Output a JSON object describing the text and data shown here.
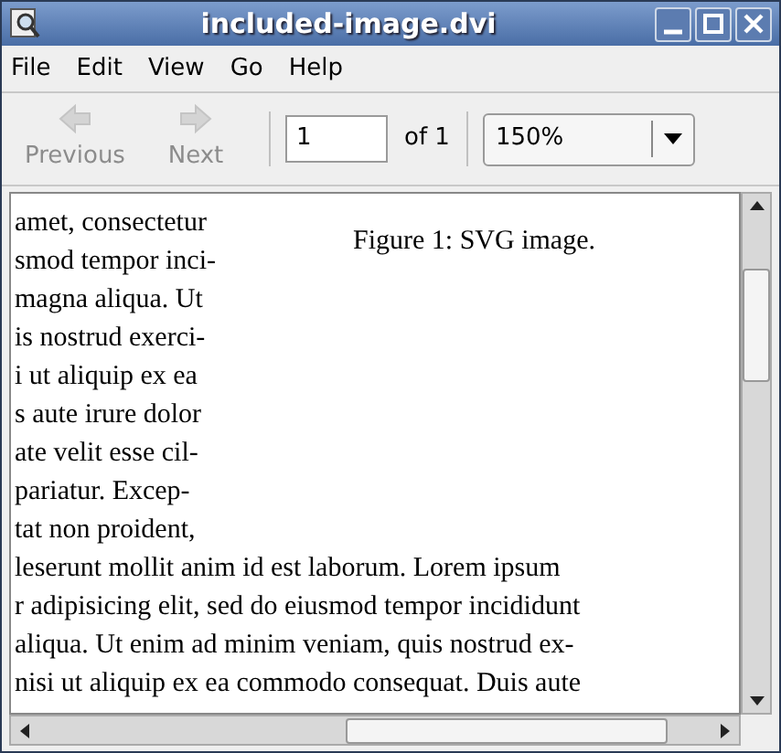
{
  "window": {
    "title": "included-image.dvi"
  },
  "menu": [
    "File",
    "Edit",
    "View",
    "Go",
    "Help"
  ],
  "toolbar": {
    "buttons": [
      {
        "label": "Previous",
        "disabled": true,
        "kind": "left"
      },
      {
        "label": "Next",
        "disabled": true,
        "kind": "right"
      }
    ],
    "page_field": {
      "value": "1"
    },
    "page_count": "of 1",
    "zoom": {
      "value": "150%"
    }
  },
  "document": {
    "figure_caption": "Figure 1: SVG image.",
    "column_lines": [
      "amet, consectetur",
      "smod tempor inci-",
      "magna aliqua. Ut",
      "is nostrud exerci-",
      "i ut aliquip ex ea",
      "s aute irure dolor",
      "ate velit esse cil-",
      "pariatur. Excep-",
      "tat non proident,"
    ],
    "full_lines": [
      "leserunt mollit anim id est laborum. Lorem ipsum",
      "r adipisicing elit, sed do eiusmod tempor incididunt",
      "aliqua. Ut enim ad minim veniam, quis nostrud ex-",
      "nisi ut aliquip ex ea commodo consequat. Duis aute"
    ]
  }
}
